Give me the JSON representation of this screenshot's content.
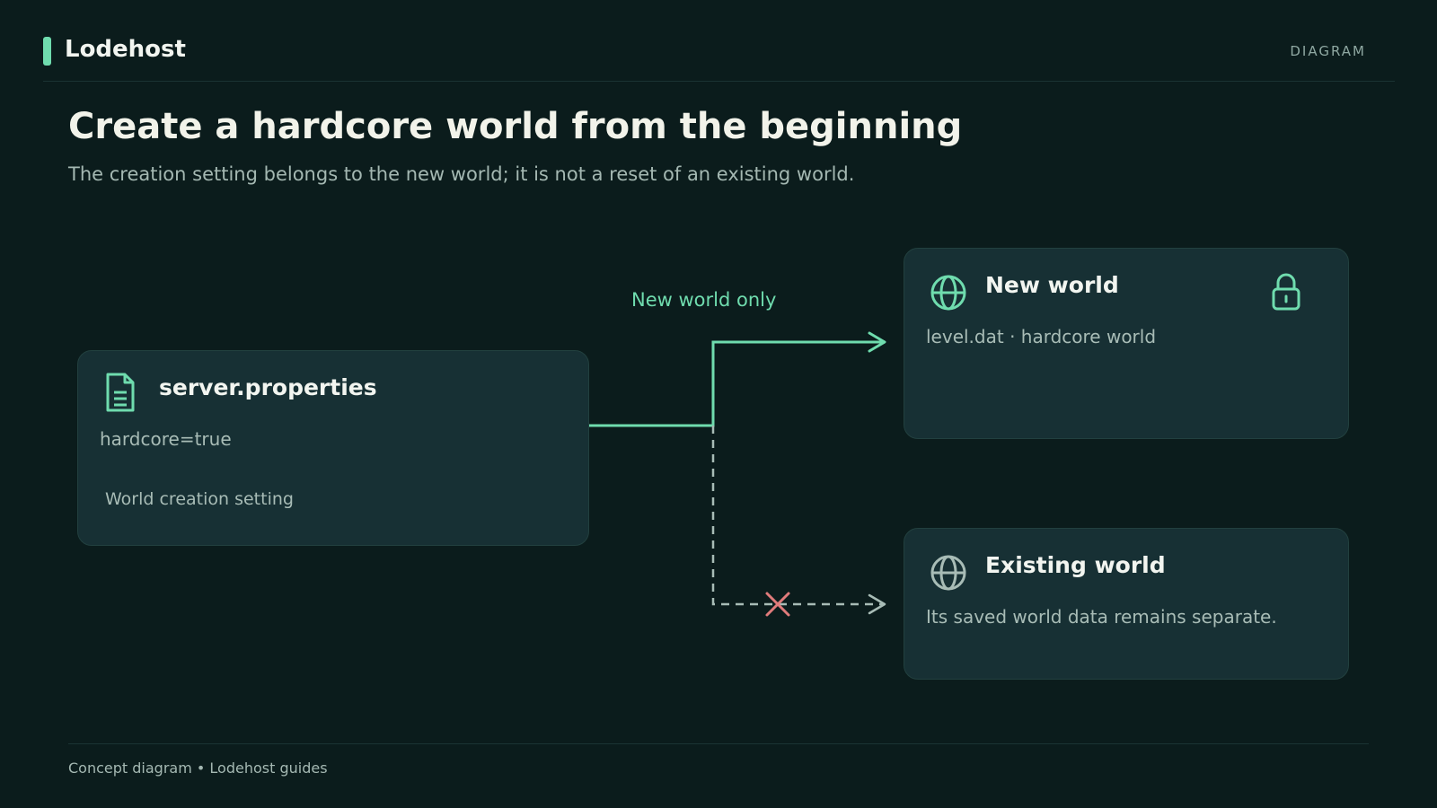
{
  "header": {
    "brand": "Lodehost",
    "tag": "DIAGRAM"
  },
  "title": "Create a hardcore world from the beginning",
  "subtitle": "The creation setting belongs to the new world; it is not a reset of an existing world.",
  "nodes": {
    "source": {
      "title": "server.properties",
      "value": "hardcore=true",
      "caption": "World creation setting",
      "icon": "document-icon"
    },
    "new_world": {
      "title": "New world",
      "value": "level.dat · hardcore world",
      "icon": "globe-icon",
      "badge_icon": "lock-icon"
    },
    "existing_world": {
      "title": "Existing world",
      "value": "Its saved world data remains separate.",
      "icon": "globe-icon"
    }
  },
  "edges": {
    "to_new": {
      "label": "New world only",
      "style": "solid",
      "color": "#6fdcae"
    },
    "to_existing": {
      "style": "dashed",
      "blocked_icon": "cross-icon",
      "color": "#a8bcb6",
      "blocked_color": "#e07b7b"
    }
  },
  "footer": "Concept diagram • Lodehost guides"
}
